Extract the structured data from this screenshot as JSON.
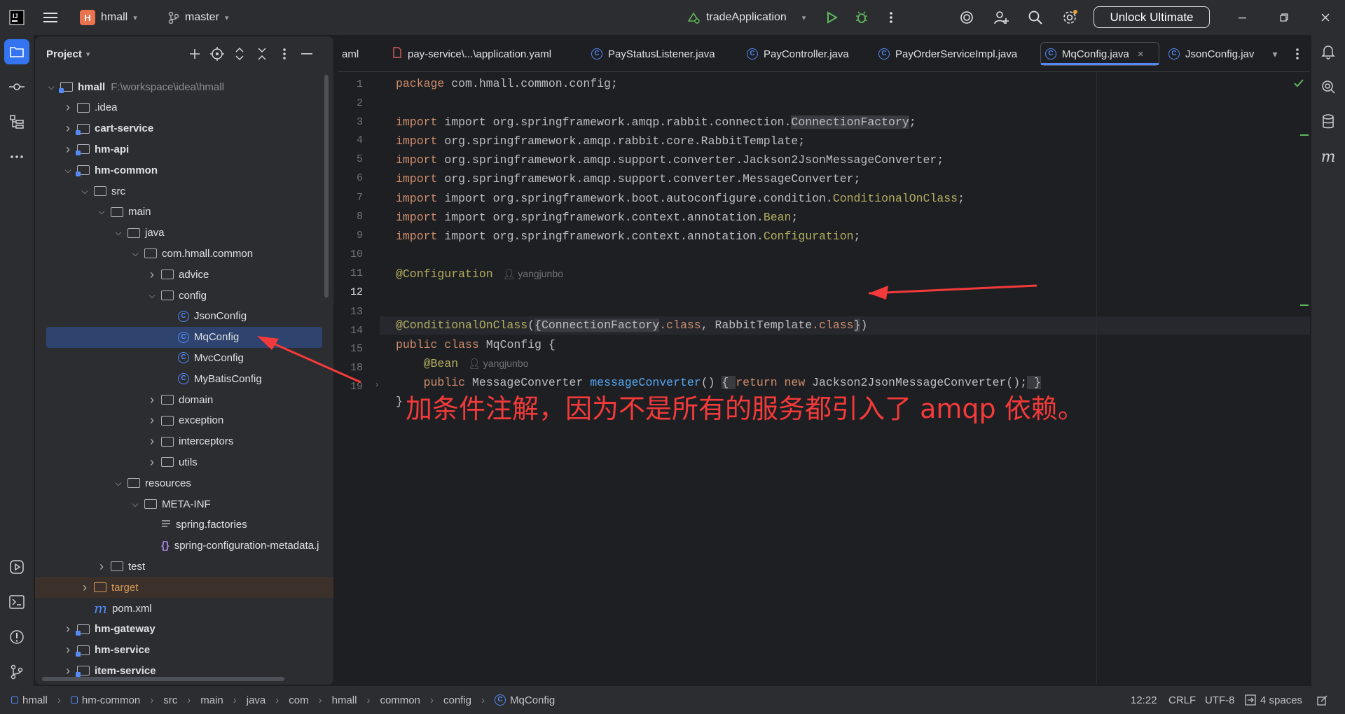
{
  "titlebar": {
    "project_initial": "H",
    "project_name": "hmall",
    "branch": "master",
    "run_config": "tradeApplication",
    "unlock_button": "Unlock Ultimate"
  },
  "project_panel": {
    "title": "Project",
    "tree": [
      {
        "label": "hmall",
        "extra": "F:\\workspace\\idea\\hmall",
        "depth": 0,
        "chev": "open",
        "icon": "module-folder",
        "bold": true
      },
      {
        "label": ".idea",
        "depth": 1,
        "chev": "closed",
        "icon": "folder"
      },
      {
        "label": "cart-service",
        "depth": 1,
        "chev": "closed",
        "icon": "module-folder",
        "bold": true
      },
      {
        "label": "hm-api",
        "depth": 1,
        "chev": "closed",
        "icon": "module-folder",
        "bold": true
      },
      {
        "label": "hm-common",
        "depth": 1,
        "chev": "open",
        "icon": "module-folder",
        "bold": true
      },
      {
        "label": "src",
        "depth": 2,
        "chev": "open",
        "icon": "folder"
      },
      {
        "label": "main",
        "depth": 3,
        "chev": "open",
        "icon": "folder"
      },
      {
        "label": "java",
        "depth": 4,
        "chev": "open",
        "icon": "source-folder"
      },
      {
        "label": "com.hmall.common",
        "depth": 5,
        "chev": "open",
        "icon": "package-folder"
      },
      {
        "label": "advice",
        "depth": 6,
        "chev": "closed",
        "icon": "package-folder"
      },
      {
        "label": "config",
        "depth": 6,
        "chev": "open",
        "icon": "package-folder"
      },
      {
        "label": "JsonConfig",
        "depth": 7,
        "chev": "none",
        "icon": "class"
      },
      {
        "label": "MqConfig",
        "depth": 7,
        "chev": "none",
        "icon": "class",
        "selected": true
      },
      {
        "label": "MvcConfig",
        "depth": 7,
        "chev": "none",
        "icon": "class"
      },
      {
        "label": "MyBatisConfig",
        "depth": 7,
        "chev": "none",
        "icon": "class"
      },
      {
        "label": "domain",
        "depth": 6,
        "chev": "closed",
        "icon": "package-folder"
      },
      {
        "label": "exception",
        "depth": 6,
        "chev": "closed",
        "icon": "package-folder"
      },
      {
        "label": "interceptors",
        "depth": 6,
        "chev": "closed",
        "icon": "package-folder"
      },
      {
        "label": "utils",
        "depth": 6,
        "chev": "closed",
        "icon": "package-folder"
      },
      {
        "label": "resources",
        "depth": 4,
        "chev": "open",
        "icon": "resources-folder"
      },
      {
        "label": "META-INF",
        "depth": 5,
        "chev": "open",
        "icon": "folder"
      },
      {
        "label": "spring.factories",
        "depth": 6,
        "chev": "none",
        "icon": "text-file"
      },
      {
        "label": "spring-configuration-metadata.j",
        "depth": 6,
        "chev": "none",
        "icon": "json-file"
      },
      {
        "label": "test",
        "depth": 3,
        "chev": "closed",
        "icon": "folder"
      },
      {
        "label": "target",
        "depth": 2,
        "chev": "closed",
        "icon": "excluded-folder",
        "orange": true
      },
      {
        "label": "pom.xml",
        "depth": 2,
        "chev": "none",
        "icon": "maven-file"
      },
      {
        "label": "hm-gateway",
        "depth": 1,
        "chev": "closed",
        "icon": "module-folder",
        "bold": true
      },
      {
        "label": "hm-service",
        "depth": 1,
        "chev": "closed",
        "icon": "module-folder",
        "bold": true
      },
      {
        "label": "item-service",
        "depth": 1,
        "chev": "closed",
        "icon": "module-folder",
        "bold": true
      }
    ]
  },
  "tabs": [
    {
      "label": "aml",
      "icon": "none"
    },
    {
      "label": "pay-service\\...\\application.yaml",
      "icon": "yaml-file"
    },
    {
      "label": "PayStatusListener.java",
      "icon": "class"
    },
    {
      "label": "PayController.java",
      "icon": "class"
    },
    {
      "label": "PayOrderServiceImpl.java",
      "icon": "class"
    },
    {
      "label": "MqConfig.java",
      "icon": "class",
      "active": true
    },
    {
      "label": "JsonConfig.jav",
      "icon": "class"
    }
  ],
  "editor": {
    "line_numbers": [
      "1",
      "2",
      "3",
      "4",
      "5",
      "6",
      "7",
      "8",
      "9",
      "10",
      "11",
      "12",
      "13",
      "14",
      "15",
      "18",
      "19"
    ],
    "lines": {
      "l1": "package com.hmall.common.config;",
      "l3a": "import org.springframework.amqp.rabbit.connection.",
      "l3b": "ConnectionFactory",
      "l3c": ";",
      "l4": "import org.springframework.amqp.rabbit.core.RabbitTemplate;",
      "l5": "import org.springframework.amqp.support.converter.Jackson2JsonMessageConverter;",
      "l6": "import org.springframework.amqp.support.converter.MessageConverter;",
      "l7a": "import org.springframework.boot.autoconfigure.condition.",
      "l7b": "ConditionalOnClass",
      "l7c": ";",
      "l8a": "import org.springframework.context.annotation.",
      "l8b": "Bean",
      "l8c": ";",
      "l9a": "import org.springframework.context.annotation.",
      "l9b": "Configuration",
      "l9c": ";",
      "l11": "@Configuration",
      "l11_hint": "yangjunbo",
      "l12a": "@ConditionalOnClass",
      "l12b": "(",
      "l12c": "{",
      "l12d": "ConnectionFactory",
      "l12e": ".class",
      "l12f": ", RabbitTemplate",
      "l12g": ".class",
      "l12h": "}",
      "l12i": ")",
      "l13a": "public class ",
      "l13b": "MqConfig {",
      "l14a": "@Bean",
      "l14_hint": "yangjunbo",
      "l15a": "public ",
      "l15b": "MessageConverter ",
      "l15c": "messageConverter",
      "l15d": "() ",
      "l15e": "{ ",
      "l15f": "return new ",
      "l15g": "Jackson2JsonMessageConverter();",
      "l15h": " }",
      "l18": "}"
    },
    "annotation_note": "加条件注解，因为不是所有的服务都引入了 amqp 依赖。"
  },
  "statusbar": {
    "crumbs": [
      "hmall",
      "hm-common",
      "src",
      "main",
      "java",
      "com",
      "hmall",
      "common",
      "config",
      "MqConfig"
    ],
    "position": "12:22",
    "line_sep": "CRLF",
    "encoding": "UTF-8",
    "indent": "4 spaces"
  },
  "colors": {
    "accent": "#548af7",
    "annotation_red": "#f43a3a",
    "selection": "#2e436e"
  }
}
